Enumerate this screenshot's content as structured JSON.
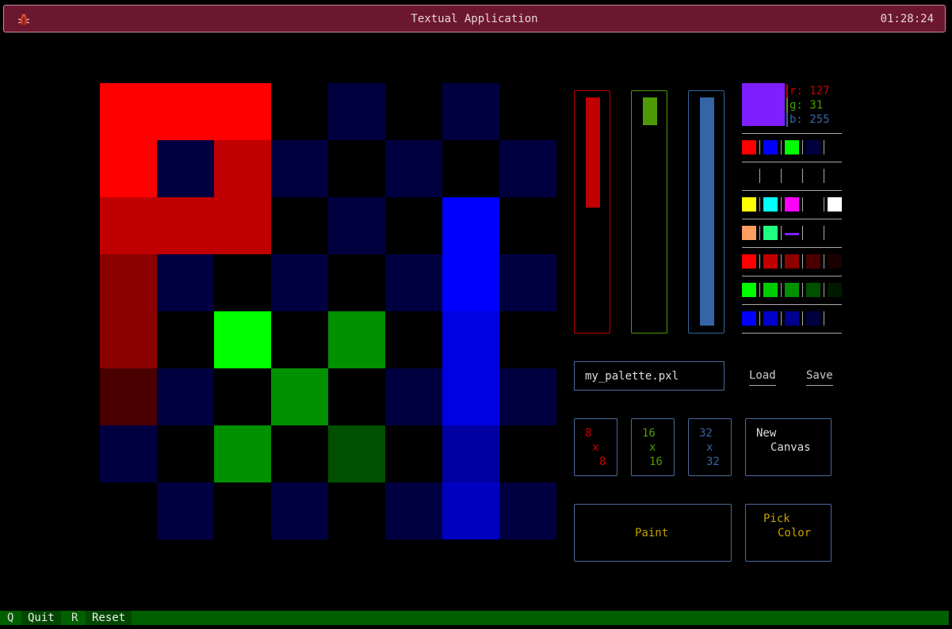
{
  "header": {
    "title": "Textual Application",
    "clock": "01:28:24"
  },
  "canvas": {
    "cols": 8,
    "rows": 8,
    "cells": [
      [
        "#ff0000",
        "#ff0000",
        "#ff0000",
        "#000000",
        "#000040",
        "#000000",
        "#000040",
        "#000000"
      ],
      [
        "#ff0000",
        "#000040",
        "#c00000",
        "#000040",
        "#000000",
        "#000040",
        "#000000",
        "#000040"
      ],
      [
        "#c00000",
        "#c00000",
        "#c00000",
        "#000000",
        "#000040",
        "#000000",
        "#0000ff",
        "#000000"
      ],
      [
        "#8c0000",
        "#000040",
        "#000000",
        "#000040",
        "#000000",
        "#000040",
        "#0000ff",
        "#000040"
      ],
      [
        "#8c0000",
        "#000000",
        "#00ff00",
        "#000000",
        "#009000",
        "#000000",
        "#0000e0",
        "#000000"
      ],
      [
        "#4a0000",
        "#000040",
        "#000000",
        "#009000",
        "#000000",
        "#000040",
        "#0000e0",
        "#000040"
      ],
      [
        "#000040",
        "#000000",
        "#009000",
        "#000000",
        "#005000",
        "#000000",
        "#0000a0",
        "#000000"
      ],
      [
        "#000000",
        "#000040",
        "#000000",
        "#000040",
        "#000000",
        "#000040",
        "#0000c0",
        "#000040"
      ]
    ]
  },
  "color": {
    "r": 127,
    "g": 31,
    "b": 255,
    "hex": "#7f1fff"
  },
  "rgb_readout": {
    "r": "r: 127",
    "g": "g: 31",
    "b": "b: 255"
  },
  "sliders": [
    {
      "name": "red",
      "border": "#c00000",
      "fill": "#c00000",
      "start": 0.0,
      "end": 0.484
    },
    {
      "name": "green",
      "border": "#4e9a06",
      "fill": "#4e9a06",
      "start": 0.0,
      "end": 0.121
    },
    {
      "name": "blue",
      "border": "#3465a4",
      "fill": "#3465a4",
      "start": 0.0,
      "end": 1.0
    }
  ],
  "palette": [
    [
      "#ff0000",
      "#0000ff",
      "#00ff00",
      "#000040",
      "#000000"
    ],
    [
      "#000000",
      "#000000",
      "#000000",
      "#000000",
      "#000000"
    ],
    [
      "#ffff00",
      "#00ffff",
      "#ff00ff",
      "#000000",
      "#ffffff"
    ],
    [
      "#ff9f5f",
      "#1fff7f",
      "#7f1fff",
      "#000000",
      "#000000"
    ],
    [
      "#ff0000",
      "#c00000",
      "#8c0000",
      "#4a0000",
      "#1a0000"
    ],
    [
      "#00ff00",
      "#00cc00",
      "#009000",
      "#005000",
      "#001a00"
    ],
    [
      "#0000ff",
      "#0000cc",
      "#000090",
      "#000040",
      "#000000"
    ]
  ],
  "file": {
    "value": "my_palette.pxl",
    "load": "Load",
    "save": "Save"
  },
  "sizes": [
    {
      "a": "8",
      "x": "x",
      "b": "8",
      "color": "#cc0000"
    },
    {
      "a": "16",
      "x": "x",
      "b": "16",
      "color": "#4e9a06"
    },
    {
      "a": "32",
      "x": "x",
      "b": "32",
      "color": "#3465a4"
    }
  ],
  "new_canvas": {
    "line1": "New",
    "line2": "Canvas"
  },
  "paint": {
    "label": "Paint"
  },
  "pick": {
    "line1": "Pick",
    "line2": "Color"
  },
  "footer": {
    "quit_key": "Q",
    "quit_label": "Quit",
    "reset_key": "R",
    "reset_label": "Reset"
  }
}
